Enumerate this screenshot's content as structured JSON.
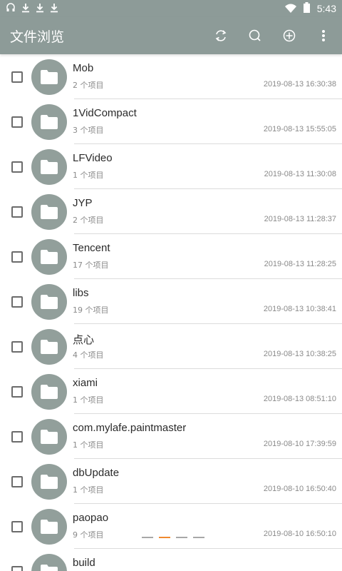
{
  "status": {
    "time": "5:43",
    "left_icons": [
      "headset-icon",
      "download-icon",
      "download-icon",
      "download-icon"
    ],
    "right_icons": [
      "wifi-icon",
      "battery-icon"
    ]
  },
  "appbar": {
    "title": "文件浏览",
    "actions": [
      "refresh-icon",
      "search-icon",
      "add-icon",
      "more-vert-icon"
    ]
  },
  "colors": {
    "appbar": "#8d9b98",
    "folder": "#929f9b",
    "pager_active": "#f08a30"
  },
  "files": [
    {
      "name": "Mob",
      "count": "2 个项目",
      "date": "2019-08-13 16:30:38"
    },
    {
      "name": "1VidCompact",
      "count": "3 个项目",
      "date": "2019-08-13 15:55:05"
    },
    {
      "name": "LFVideo",
      "count": "1 个项目",
      "date": "2019-08-13 11:30:08"
    },
    {
      "name": "JYP",
      "count": "2 个项目",
      "date": "2019-08-13 11:28:37"
    },
    {
      "name": "Tencent",
      "count": "17 个项目",
      "date": "2019-08-13 11:28:25"
    },
    {
      "name": "libs",
      "count": "19 个项目",
      "date": "2019-08-13 10:38:41"
    },
    {
      "name": "点心",
      "count": "4 个项目",
      "date": "2019-08-13 10:38:25"
    },
    {
      "name": "xiami",
      "count": "1 个项目",
      "date": "2019-08-13 08:51:10"
    },
    {
      "name": "com.mylafe.paintmaster",
      "count": "1 个项目",
      "date": "2019-08-10 17:39:59"
    },
    {
      "name": "dbUpdate",
      "count": "1 个项目",
      "date": "2019-08-10 16:50:40"
    },
    {
      "name": "paopao",
      "count": "9 个项目",
      "date": "2019-08-10 16:50:10"
    },
    {
      "name": "build",
      "count": "",
      "date": ""
    }
  ],
  "pager": {
    "count": 4,
    "active": 1
  }
}
